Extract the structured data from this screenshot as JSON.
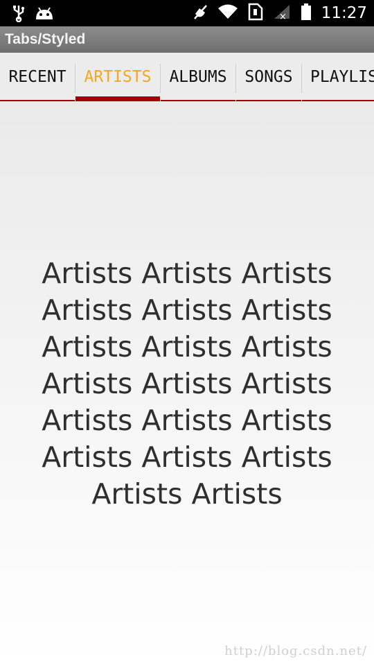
{
  "status_bar": {
    "time": "11:27",
    "icons": [
      "usb-icon",
      "android-icon",
      "mute-icon",
      "wifi-icon",
      "sim-icon",
      "signal-icon",
      "battery-icon"
    ]
  },
  "title_bar": {
    "title": "Tabs/Styled"
  },
  "tabs": [
    {
      "label": "RECENT",
      "active": false
    },
    {
      "label": "ARTISTS",
      "active": true
    },
    {
      "label": "ALBUMS",
      "active": false
    },
    {
      "label": "SONGS",
      "active": false
    },
    {
      "label": "PLAYLISTS",
      "active": false
    }
  ],
  "content": {
    "text": "Artists Artists Artists Artists Artists Artists Artists Artists Artists Artists Artists Artists Artists Artists Artists Artists Artists Artists Artists Artists"
  },
  "watermark": "http://blog.csdn.net/",
  "colors": {
    "active_tab_text": "#f5a623",
    "tab_indicator": "#a60000",
    "title_bar": "#7d7d7d"
  }
}
